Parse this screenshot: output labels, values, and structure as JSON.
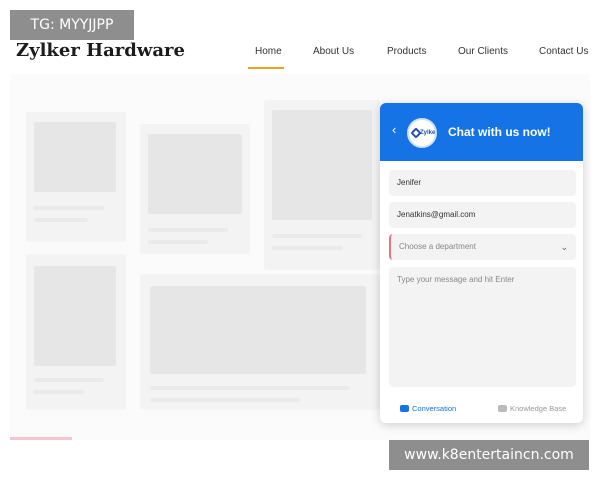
{
  "watermarks": {
    "top": "TG: MYYJJPP",
    "bottom": "www.k8entertaincn.com"
  },
  "site": {
    "brand": "Zylker Hardware",
    "nav": [
      {
        "label": "Home",
        "active": true
      },
      {
        "label": "About Us",
        "active": false
      },
      {
        "label": "Products",
        "active": false
      },
      {
        "label": "Our Clients",
        "active": false
      },
      {
        "label": "Contact Us",
        "active": false
      }
    ],
    "accent_color": "#f0a020"
  },
  "chat": {
    "back_icon": "chevron-left-icon",
    "logo_text": "Zylker",
    "title": "Chat with us now!",
    "header_color": "#1573e6",
    "name_value": "Jenifer",
    "email_value": "Jenatkins@gmail.com",
    "department_placeholder": "Choose a department",
    "message_placeholder": "Type your message and hit Enter",
    "tabs": [
      {
        "label": "Conversation",
        "icon": "conversation-icon",
        "active": true
      },
      {
        "label": "Knowledge Base",
        "icon": "knowledge-base-icon",
        "active": false
      }
    ]
  }
}
